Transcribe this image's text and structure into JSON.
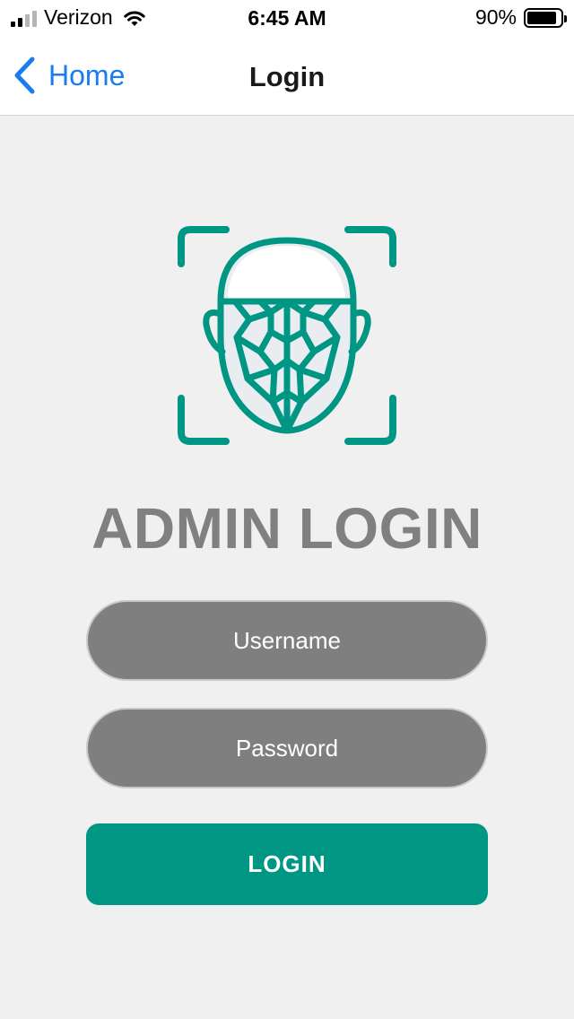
{
  "status_bar": {
    "carrier": "Verizon",
    "time": "6:45 AM",
    "battery_percent": "90%",
    "battery_level": 0.9,
    "signal_bars": 2,
    "icons": [
      "cellular-signal-icon",
      "wifi-icon",
      "battery-icon"
    ]
  },
  "nav": {
    "back_label": "Home",
    "back_icon": "chevron-left-icon",
    "title": "Login"
  },
  "logo": {
    "icon": "face-scan-icon",
    "color": "#009684"
  },
  "main": {
    "title": "ADMIN LOGIN",
    "username_placeholder": "Username",
    "username_value": "",
    "password_placeholder": "Password",
    "password_value": "",
    "login_label": "LOGIN"
  },
  "colors": {
    "accent": "#009684",
    "ios_blue": "#1a7cf0",
    "field_bg": "#7f7f7f",
    "title_gray": "#808080",
    "background": "#f0f0f0"
  }
}
